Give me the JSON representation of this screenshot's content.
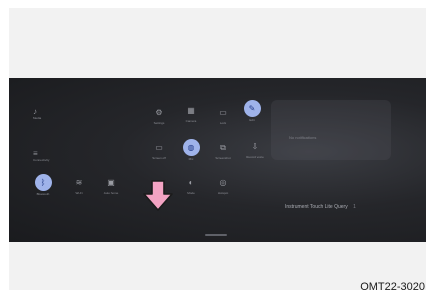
{
  "left_panel": {
    "items": [
      {
        "icon": "media-icon",
        "label": "Media"
      },
      {
        "icon": "connectivity-icon",
        "label": "Connectivity"
      }
    ]
  },
  "tiles": [
    {
      "icon": "settings-icon",
      "label": "Settings"
    },
    {
      "icon": "camera-icon",
      "label": "Camera"
    },
    {
      "icon": "lock-icon",
      "label": "Lock"
    },
    {
      "icon": "edit-icon",
      "label": "Edit",
      "active": true
    },
    {
      "icon": "screen-off-icon",
      "label": "Screen off"
    },
    {
      "icon": "mic-icon",
      "label": "Mic",
      "active": true
    },
    {
      "icon": "screenshot-icon",
      "label": "Screenshot"
    },
    {
      "icon": "record-icon",
      "label": "Record voice"
    },
    {
      "icon": "bluetooth-icon",
      "label": "Bluetooth",
      "active": true
    },
    {
      "icon": "wifi-icon",
      "label": "Wi-Fi"
    },
    {
      "icon": "auto-home-icon",
      "label": "Auto home"
    },
    {
      "icon": "dnd-icon",
      "label": "DND"
    },
    {
      "icon": "mode-icon",
      "label": "Mode"
    },
    {
      "icon": "hotspot-icon",
      "label": "Hotspot"
    }
  ],
  "right_panel": {
    "card_text": "No notifications",
    "notification": "Instrument Touch Lite Query",
    "notification_count": "1"
  },
  "figure_code": "OMT22-3020",
  "colors": {
    "screen_bg": "#25262a",
    "active_tile": "#9fb3ea",
    "arrow_fill": "#f3a3c3"
  }
}
